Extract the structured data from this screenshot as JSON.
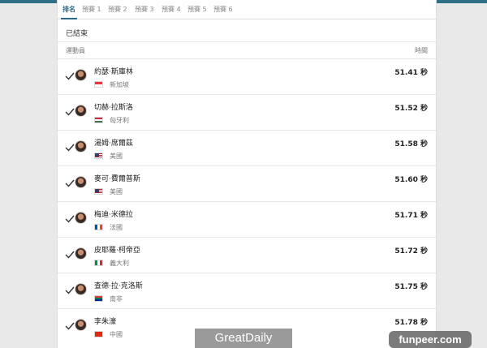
{
  "tabs": [
    "排名",
    "預賽 1",
    "預賽 2",
    "預賽 3",
    "預賽 4",
    "預賽 5",
    "預賽 6"
  ],
  "active_tab": 0,
  "status": "已結束",
  "columns": {
    "athlete": "運動員",
    "time": "時間"
  },
  "athletes": [
    {
      "name": "約瑟·斯庫林",
      "country": "新加坡",
      "time": "51.41 秒",
      "flag": "sg"
    },
    {
      "name": "切赫·拉斯洛",
      "country": "匈牙利",
      "time": "51.52 秒",
      "flag": "hu"
    },
    {
      "name": "湯姆·席爾茲",
      "country": "美國",
      "time": "51.58 秒",
      "flag": "us"
    },
    {
      "name": "麥可·費爾普斯",
      "country": "美國",
      "time": "51.60 秒",
      "flag": "us"
    },
    {
      "name": "梅迪·米德拉",
      "country": "法國",
      "time": "51.71 秒",
      "flag": "fr"
    },
    {
      "name": "皮耶羅·柯帝亞",
      "country": "義大利",
      "time": "51.72 秒",
      "flag": "it"
    },
    {
      "name": "查德·拉·克洛斯",
      "country": "南非",
      "time": "51.75 秒",
      "flag": "za"
    },
    {
      "name": "李朱濠",
      "country": "中國",
      "time": "51.78 秒",
      "flag": "cn"
    }
  ],
  "watermarks": {
    "left": "GreatDaily",
    "right": "funpeer.com"
  },
  "colors": {
    "accent": "#2b6a86",
    "topbar": "#2f6f86"
  }
}
